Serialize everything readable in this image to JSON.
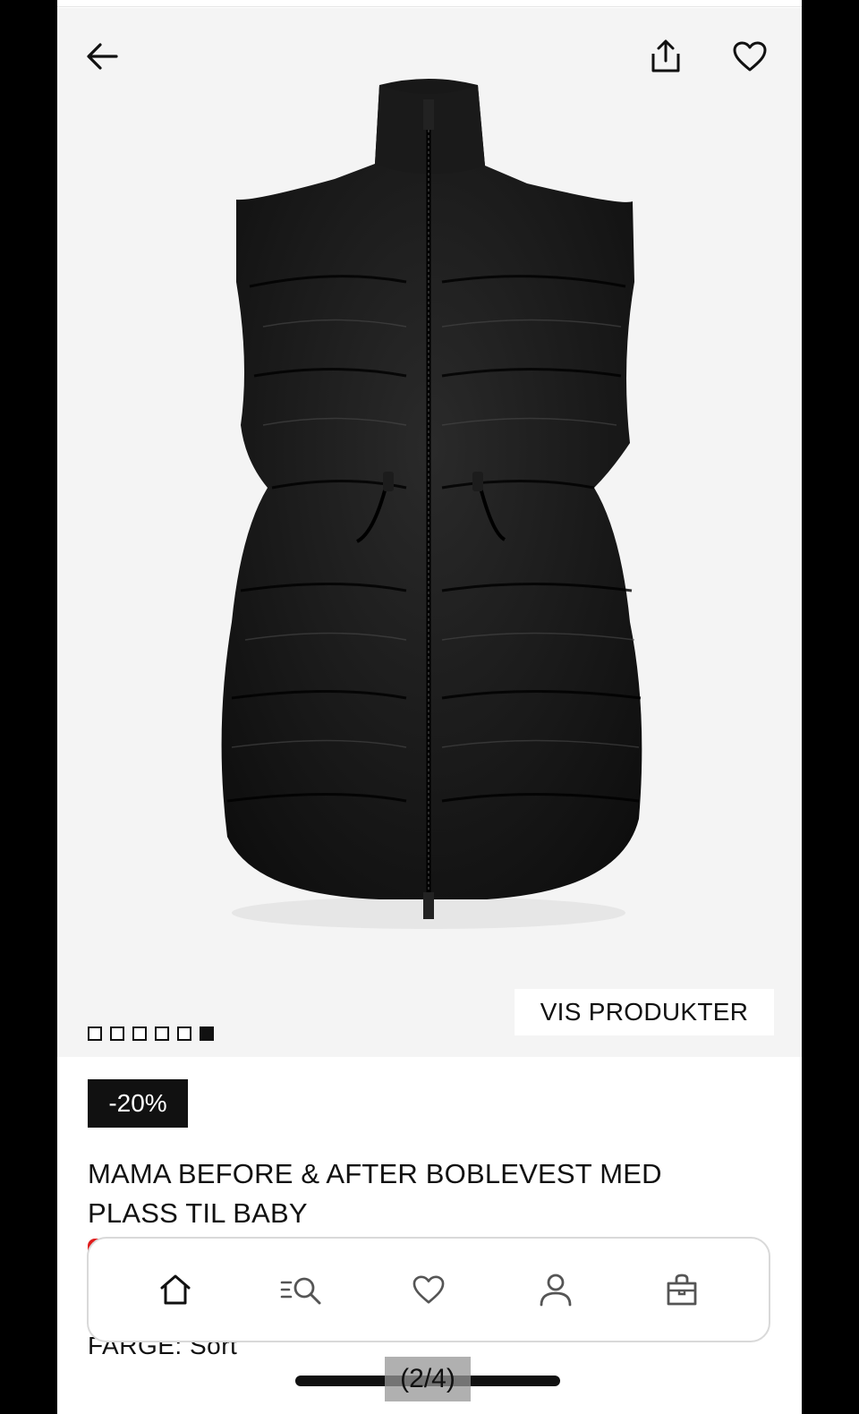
{
  "header": {
    "back_icon": "arrow-left-icon",
    "share_icon": "share-icon",
    "wishlist_icon": "heart-icon"
  },
  "gallery": {
    "image_alt": "Black quilted puffer vest with drawstring waist",
    "dots_total": 6,
    "active_dot": 6,
    "vis_produkter_label": "VIS PRODUKTER"
  },
  "product": {
    "discount_badge": "-20%",
    "title_line1": "MAMA BEFORE & AFTER BOBLEVEST MED",
    "title_line2": "PLASS TIL BABY",
    "color_label": "FARGE: Sort"
  },
  "bottom_nav": {
    "items": [
      {
        "icon": "home-icon"
      },
      {
        "icon": "search-icon"
      },
      {
        "icon": "heart-icon"
      },
      {
        "icon": "account-icon"
      },
      {
        "icon": "bag-icon"
      }
    ]
  },
  "overlay": {
    "page_counter": "(2/4)"
  },
  "colors": {
    "background": "#ffffff",
    "gallery_bg": "#f4f4f4",
    "badge_bg": "#111111",
    "accent_red": "#e01c1c"
  }
}
